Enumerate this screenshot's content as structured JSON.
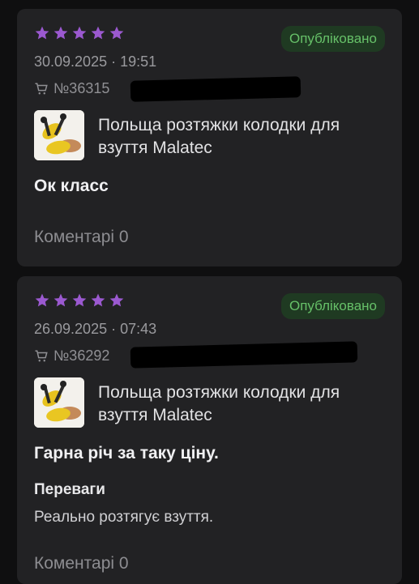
{
  "reviews": [
    {
      "status": "Опубліковано",
      "date": "30.09.2025 · 19:51",
      "order_visible": "№36315",
      "product_name": "Польща розтяжки колодки  для взуття Malatec",
      "text": "Ок класс",
      "comments": "Коментарі 0",
      "rating": 5
    },
    {
      "status": "Опубліковано",
      "date": "26.09.2025 · 07:43",
      "order_visible": "№36292",
      "product_name": "Польща розтяжки колодки  для взуття Malatec",
      "text": "Гарна річ за таку ціну.",
      "pros_title": "Переваги",
      "pros_text": "Реально розтягує взуття.",
      "comments": "Коментарі 0",
      "rating": 5
    }
  ],
  "colors": {
    "star": "#9b59d0",
    "badge_bg": "#1f3a22",
    "badge_text": "#66c068",
    "card_bg": "#222224"
  },
  "icons": {
    "star": "star-icon",
    "cart": "cart-icon"
  }
}
